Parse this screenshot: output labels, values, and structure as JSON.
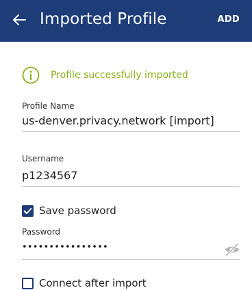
{
  "app_bar": {
    "title": "Imported Profile",
    "action_label": "ADD",
    "background_color": "#1e3c78",
    "back_icon": "arrow-left-icon"
  },
  "status": {
    "message": "Profile successfully imported",
    "icon": "info-circle-icon",
    "color": "#8bb11c"
  },
  "form": {
    "profile_name": {
      "label": "Profile Name",
      "value": "us-denver.privacy.network [import]"
    },
    "username": {
      "label": "Username",
      "value": "p1234567"
    },
    "save_password": {
      "label": "Save password",
      "checked": true
    },
    "password": {
      "label": "Password",
      "value": "••••••••••••••••",
      "visibility_icon": "eye-off-icon"
    },
    "connect_after_import": {
      "label": "Connect after import",
      "checked": false
    }
  }
}
